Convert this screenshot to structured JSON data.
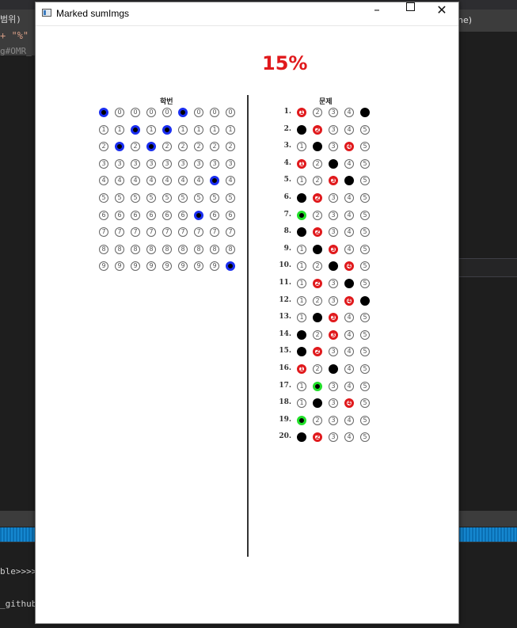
{
  "background": {
    "left_label": "범위)",
    "left_code": "+ \"%\"",
    "left_path": "g#OMR_",
    "right_label": "ne)",
    "output_line1": "ble>>>>,",
    "output_line2": "_github."
  },
  "window": {
    "title": "Marked sumImgs",
    "controls": {
      "minimize": "–",
      "maximize": "□",
      "close": "✕"
    }
  },
  "score": "15%",
  "student_id": {
    "title": "학번",
    "digits": [
      "0",
      "1",
      "2",
      "3",
      "4",
      "5",
      "6",
      "7",
      "8",
      "9"
    ],
    "marked_digit_per_column": [
      0,
      2,
      1,
      2,
      1,
      0,
      6,
      4,
      9
    ]
  },
  "answers": {
    "title": "문제",
    "options": [
      "1",
      "2",
      "3",
      "4",
      "5"
    ],
    "questions": [
      {
        "number": "1.",
        "marked": [
          5
        ],
        "correct": 1,
        "result": "wrong"
      },
      {
        "number": "2.",
        "marked": [
          1
        ],
        "correct": 2,
        "result": "wrong"
      },
      {
        "number": "3.",
        "marked": [
          2
        ],
        "correct": 4,
        "result": "wrong"
      },
      {
        "number": "4.",
        "marked": [
          3
        ],
        "correct": 1,
        "result": "wrong"
      },
      {
        "number": "5.",
        "marked": [
          4
        ],
        "correct": 3,
        "result": "wrong"
      },
      {
        "number": "6.",
        "marked": [
          1
        ],
        "correct": 2,
        "result": "wrong"
      },
      {
        "number": "7.",
        "marked": [
          1
        ],
        "correct": 1,
        "result": "right"
      },
      {
        "number": "8.",
        "marked": [
          1
        ],
        "correct": 2,
        "result": "wrong"
      },
      {
        "number": "9.",
        "marked": [
          2
        ],
        "correct": 3,
        "result": "wrong"
      },
      {
        "number": "10.",
        "marked": [
          3
        ],
        "correct": 4,
        "result": "wrong"
      },
      {
        "number": "11.",
        "marked": [
          4
        ],
        "correct": 2,
        "result": "wrong"
      },
      {
        "number": "12.",
        "marked": [
          5
        ],
        "correct": 4,
        "result": "wrong"
      },
      {
        "number": "13.",
        "marked": [
          2
        ],
        "correct": 3,
        "result": "wrong"
      },
      {
        "number": "14.",
        "marked": [
          1
        ],
        "correct": 3,
        "result": "wrong"
      },
      {
        "number": "15.",
        "marked": [
          1
        ],
        "correct": 2,
        "result": "wrong"
      },
      {
        "number": "16.",
        "marked": [
          3
        ],
        "correct": 1,
        "result": "wrong"
      },
      {
        "number": "17.",
        "marked": [
          2
        ],
        "correct": 2,
        "result": "right"
      },
      {
        "number": "18.",
        "marked": [
          2
        ],
        "correct": 4,
        "result": "wrong"
      },
      {
        "number": "19.",
        "marked": [
          1
        ],
        "correct": 1,
        "result": "right"
      },
      {
        "number": "20.",
        "marked": [
          1
        ],
        "correct": 2,
        "result": "wrong"
      }
    ]
  },
  "colors": {
    "correct_mark": "#22e02a",
    "wrong_mark": "#e0191c",
    "id_mark": "#1a2ef0",
    "score_text": "#e0191c"
  }
}
